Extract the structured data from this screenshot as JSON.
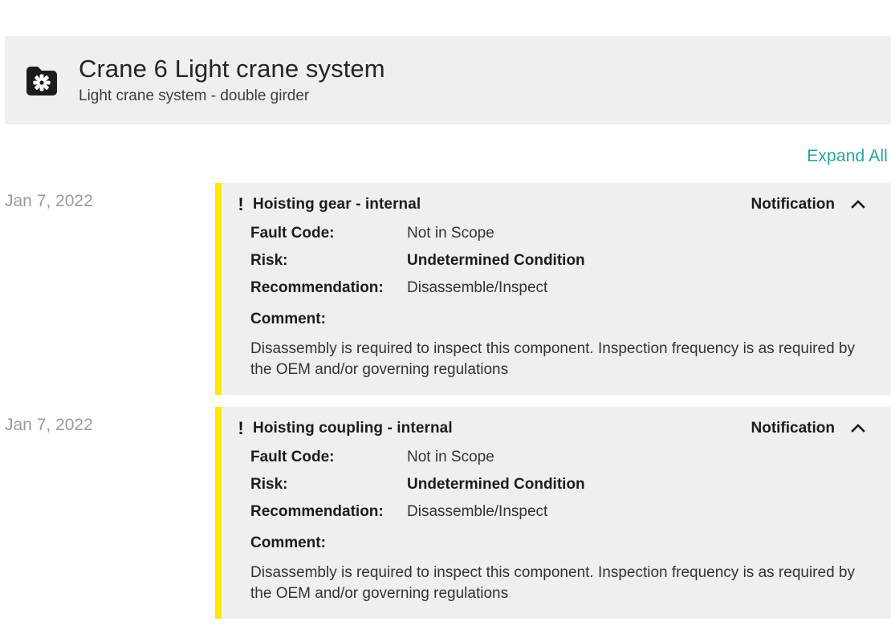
{
  "asset": {
    "icon": "folder-gear-icon",
    "title": "Crane 6 Light crane system",
    "subtitle": "Light crane system - double girder"
  },
  "toolbar": {
    "expand_all_label": "Expand All"
  },
  "colors": {
    "accent_link": "#25a3a3",
    "severity_bar": "#ffe800",
    "card_background": "#efefef",
    "date_text": "#9a9a9a"
  },
  "field_labels": {
    "fault_code": "Fault Code:",
    "risk": "Risk:",
    "recommendation": "Recommendation:",
    "comment": "Comment:"
  },
  "entries": [
    {
      "date": "Jan 7, 2022",
      "severity_icon": "exclamation-icon",
      "title": "Hoisting gear - internal",
      "kind": "Notification",
      "chevron": "chevron-up-icon",
      "fault_code": "Not in Scope",
      "risk": "Undetermined Condition",
      "recommendation": "Disassemble/Inspect",
      "comment": "Disassembly is required to inspect this component. Inspection frequency is as required by the OEM and/or governing regulations"
    },
    {
      "date": "Jan 7, 2022",
      "severity_icon": "exclamation-icon",
      "title": "Hoisting coupling - internal",
      "kind": "Notification",
      "chevron": "chevron-up-icon",
      "fault_code": "Not in Scope",
      "risk": "Undetermined Condition",
      "recommendation": "Disassemble/Inspect",
      "comment": "Disassembly is required to inspect this component. Inspection frequency is as required by the OEM and/or governing regulations"
    }
  ]
}
